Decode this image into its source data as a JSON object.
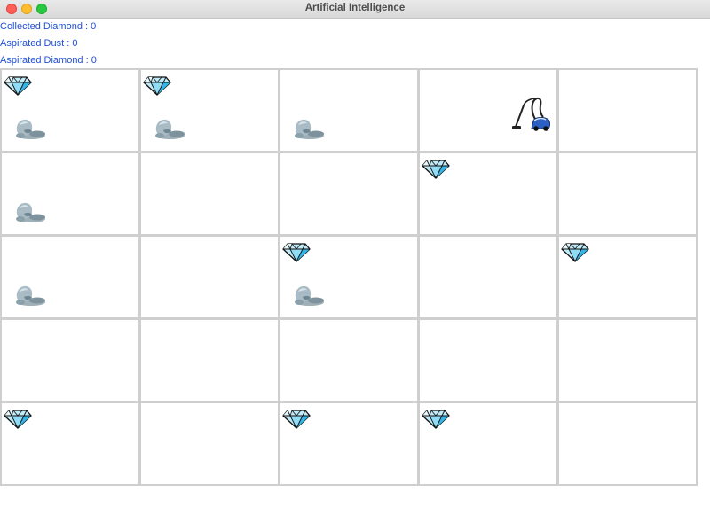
{
  "window": {
    "title": "Artificial Intelligence"
  },
  "stats": {
    "collected_diamond": "Collected Diamond : 0",
    "aspirated_dust": "Aspirated Dust : 0",
    "aspirated_diamond": "Aspirated Diamond : 0"
  },
  "grid": {
    "rows": [
      [
        {
          "diamond": true,
          "dust": true,
          "vacuum": false
        },
        {
          "diamond": true,
          "dust": true,
          "vacuum": false
        },
        {
          "diamond": false,
          "dust": true,
          "vacuum": false
        },
        {
          "diamond": false,
          "dust": false,
          "vacuum": true
        },
        {
          "diamond": false,
          "dust": false,
          "vacuum": false
        }
      ],
      [
        {
          "diamond": false,
          "dust": true,
          "vacuum": false
        },
        {
          "diamond": false,
          "dust": false,
          "vacuum": false
        },
        {
          "diamond": false,
          "dust": false,
          "vacuum": false
        },
        {
          "diamond": true,
          "dust": false,
          "vacuum": false
        },
        {
          "diamond": false,
          "dust": false,
          "vacuum": false
        }
      ],
      [
        {
          "diamond": false,
          "dust": true,
          "vacuum": false
        },
        {
          "diamond": false,
          "dust": false,
          "vacuum": false
        },
        {
          "diamond": true,
          "dust": true,
          "vacuum": false
        },
        {
          "diamond": false,
          "dust": false,
          "vacuum": false
        },
        {
          "diamond": true,
          "dust": false,
          "vacuum": false
        }
      ],
      [
        {
          "diamond": false,
          "dust": false,
          "vacuum": false
        },
        {
          "diamond": false,
          "dust": false,
          "vacuum": false
        },
        {
          "diamond": false,
          "dust": false,
          "vacuum": false
        },
        {
          "diamond": false,
          "dust": false,
          "vacuum": false
        },
        {
          "diamond": false,
          "dust": false,
          "vacuum": false
        }
      ],
      [
        {
          "diamond": true,
          "dust": false,
          "vacuum": false
        },
        {
          "diamond": false,
          "dust": false,
          "vacuum": false
        },
        {
          "diamond": true,
          "dust": false,
          "vacuum": false
        },
        {
          "diamond": true,
          "dust": false,
          "vacuum": false
        },
        {
          "diamond": false,
          "dust": false,
          "vacuum": false
        }
      ]
    ]
  },
  "icons": {
    "diamond": "diamond-icon",
    "dust": "dust-icon",
    "vacuum": "vacuum-icon"
  },
  "colors": {
    "stat_text": "#1f4fd8",
    "grid_border": "#cfcfcf",
    "diamond": "#7fd3f0",
    "vacuum": "#2b5fc4"
  }
}
